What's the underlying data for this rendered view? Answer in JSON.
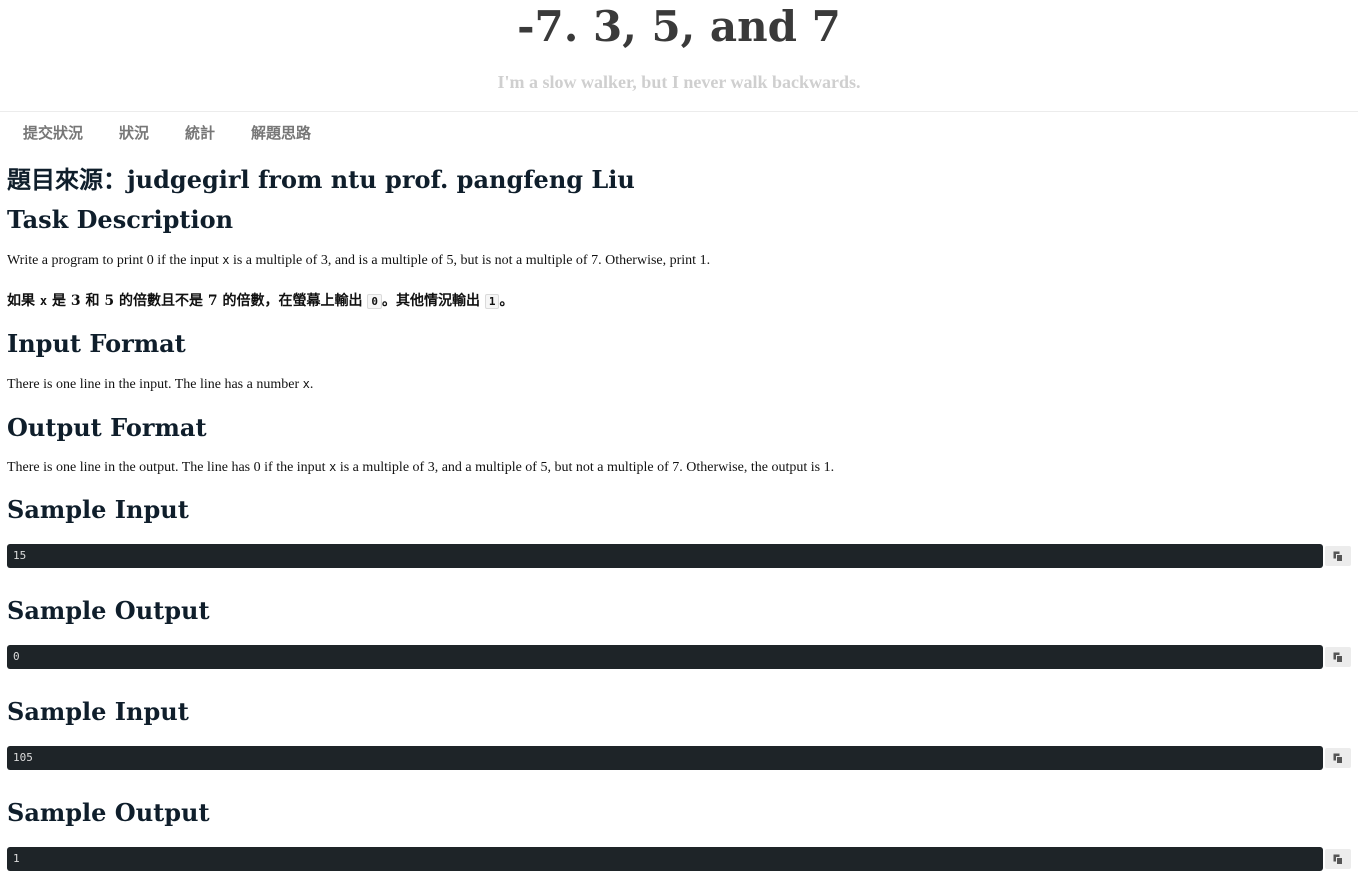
{
  "header": {
    "title": "-7. 3, 5, and 7",
    "subtitle": "I'm a slow walker, but I never walk backwards."
  },
  "nav": {
    "items": [
      {
        "label": "提交狀況"
      },
      {
        "label": "狀況"
      },
      {
        "label": "統計"
      },
      {
        "label": "解題思路"
      }
    ]
  },
  "problem": {
    "source": "題目來源：judgegirl from ntu prof. pangfeng Liu",
    "task_heading": "Task Description",
    "task_en": {
      "p1": "Write a program to print ",
      "v0": "0",
      "p2": " if the input ",
      "var": "x",
      "p3": " is a multiple of ",
      "v3": "3",
      "p4": ", and is a multiple of ",
      "v5": "5",
      "p5": ", but is not a multiple of ",
      "v7": "7",
      "p6": ". Otherwise, print ",
      "v1": "1",
      "p7": "."
    },
    "task_zh": {
      "p1": "如果 ",
      "var": "x",
      "p2": " 是 ",
      "v3": "3",
      "p3": " 和 ",
      "v5": "5",
      "p4": " 的倍數且不是 ",
      "v7": "7",
      "p5": " 的倍數，在螢幕上輸出 ",
      "c0": "0",
      "p6": "。其他情況輸出 ",
      "c1": "1",
      "p7": "。"
    },
    "input_heading": "Input Format",
    "input_text": {
      "p1": "There is one line in the input. The line has a number ",
      "var": "x",
      "p2": "."
    },
    "output_heading": "Output Format",
    "output_text": {
      "p1": "There is one line in the output. The line has ",
      "v0": "0",
      "p2": " if the input ",
      "var": "x",
      "p3": " is a multiple of ",
      "v3": "3",
      "p4": ", and a multiple of ",
      "v5": "5",
      "p5": ", but not a multiple of ",
      "v7": "7",
      "p6": ". Otherwise, the output is ",
      "v1": "1",
      "p7": "."
    },
    "samples": [
      {
        "heading": "Sample Input",
        "code": "15"
      },
      {
        "heading": "Sample Output",
        "code": "0"
      },
      {
        "heading": "Sample Input",
        "code": "105"
      },
      {
        "heading": "Sample Output",
        "code": "1"
      }
    ],
    "copy_icon": "copy-icon"
  }
}
